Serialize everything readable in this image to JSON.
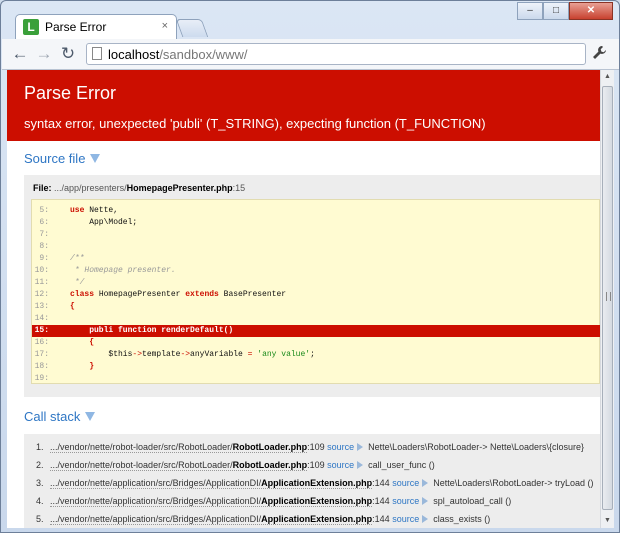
{
  "browser": {
    "tab_title": "Parse Error",
    "tab_close": "×",
    "url_host": "localhost",
    "url_path": "/sandbox/www/",
    "back_icon": "←",
    "forward_icon": "→",
    "reload_icon": "↻",
    "wrench_icon": "🔧",
    "minimize": "–",
    "maximize": "□",
    "close": "✕"
  },
  "error": {
    "title": "Parse Error",
    "message": "syntax error, unexpected 'publi' (T_STRING), expecting function (T_FUNCTION)"
  },
  "source": {
    "heading": "Source file",
    "file_label": "File:",
    "file_path_dim": ".../app/presenters/",
    "file_name": "HomepagePresenter.php",
    "file_line": ":15",
    "lines": [
      {
        "num": "5:",
        "text": "use Nette,"
      },
      {
        "num": "6:",
        "text": "    App\\Model;"
      },
      {
        "num": "7:",
        "text": ""
      },
      {
        "num": "8:",
        "text": ""
      },
      {
        "num": "9:",
        "text": "/**"
      },
      {
        "num": "10:",
        "text": " * Homepage presenter."
      },
      {
        "num": "11:",
        "text": " */"
      },
      {
        "num": "12:",
        "text": "class HomepagePresenter extends BasePresenter"
      },
      {
        "num": "13:",
        "text": "{"
      },
      {
        "num": "14:",
        "text": ""
      },
      {
        "num": "15:",
        "text": "    publi function renderDefault()"
      },
      {
        "num": "16:",
        "text": "    {"
      },
      {
        "num": "17:",
        "text": "        $this->template->anyVariable = 'any value';"
      },
      {
        "num": "18:",
        "text": "    }"
      },
      {
        "num": "19:",
        "text": ""
      }
    ]
  },
  "callstack": {
    "heading": "Call stack",
    "rows": [
      {
        "num": "1.",
        "path": ".../vendor/nette/robot-loader/src/RobotLoader/",
        "file": "RobotLoader.php",
        "line": ":109",
        "source": "source",
        "call": "Nette\\Loaders\\RobotLoader-> Nette\\Loaders\\{closure}"
      },
      {
        "num": "2.",
        "path": ".../vendor/nette/robot-loader/src/RobotLoader/",
        "file": "RobotLoader.php",
        "line": ":109",
        "source": "source",
        "call": "call_user_func ()"
      },
      {
        "num": "3.",
        "path": ".../vendor/nette/application/src/Bridges/ApplicationDI/",
        "file": "ApplicationExtension.php",
        "line": ":144",
        "source": "source",
        "call": "Nette\\Loaders\\RobotLoader-> tryLoad ()"
      },
      {
        "num": "4.",
        "path": ".../vendor/nette/application/src/Bridges/ApplicationDI/",
        "file": "ApplicationExtension.php",
        "line": ":144",
        "source": "source",
        "call": "spl_autoload_call ()"
      },
      {
        "num": "5.",
        "path": ".../vendor/nette/application/src/Bridges/ApplicationDI/",
        "file": "ApplicationExtension.php",
        "line": ":144",
        "source": "source",
        "call": "class_exists ()"
      }
    ]
  },
  "colors": {
    "error_red": "#cc0e00",
    "link_blue": "#2e76c4",
    "code_bg": "#fffbd2"
  }
}
